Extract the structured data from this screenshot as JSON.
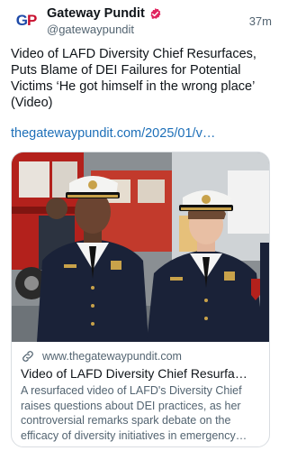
{
  "post": {
    "author_name": "Gateway Pundit",
    "author_handle": "@gatewaypundit",
    "time_ago": "37m",
    "avatar_text": {
      "left": "G",
      "right": "P"
    },
    "text": "Video of LAFD Diversity Chief Resurfaces, Puts Blame of DEI Failures for Potential Victims ‘He got himself in the wrong place’ (Video)",
    "link": "thegatewaypundit.com/2025/01/v…"
  },
  "card": {
    "domain": "www.thegatewaypundit.com",
    "title": "Video of LAFD Diversity Chief Resurfa…",
    "description": "A resurfaced video of LAFD's Diversity Chief raises questions about DEI practices, as her controversial remarks spark debate on the efficacy of diversity initiatives in emergency…"
  },
  "icons": {
    "verified": "verified-badge-icon",
    "link": "link-icon"
  },
  "colors": {
    "verified": "#e0245e",
    "link": "#1d6fb8",
    "muted": "#536471"
  }
}
